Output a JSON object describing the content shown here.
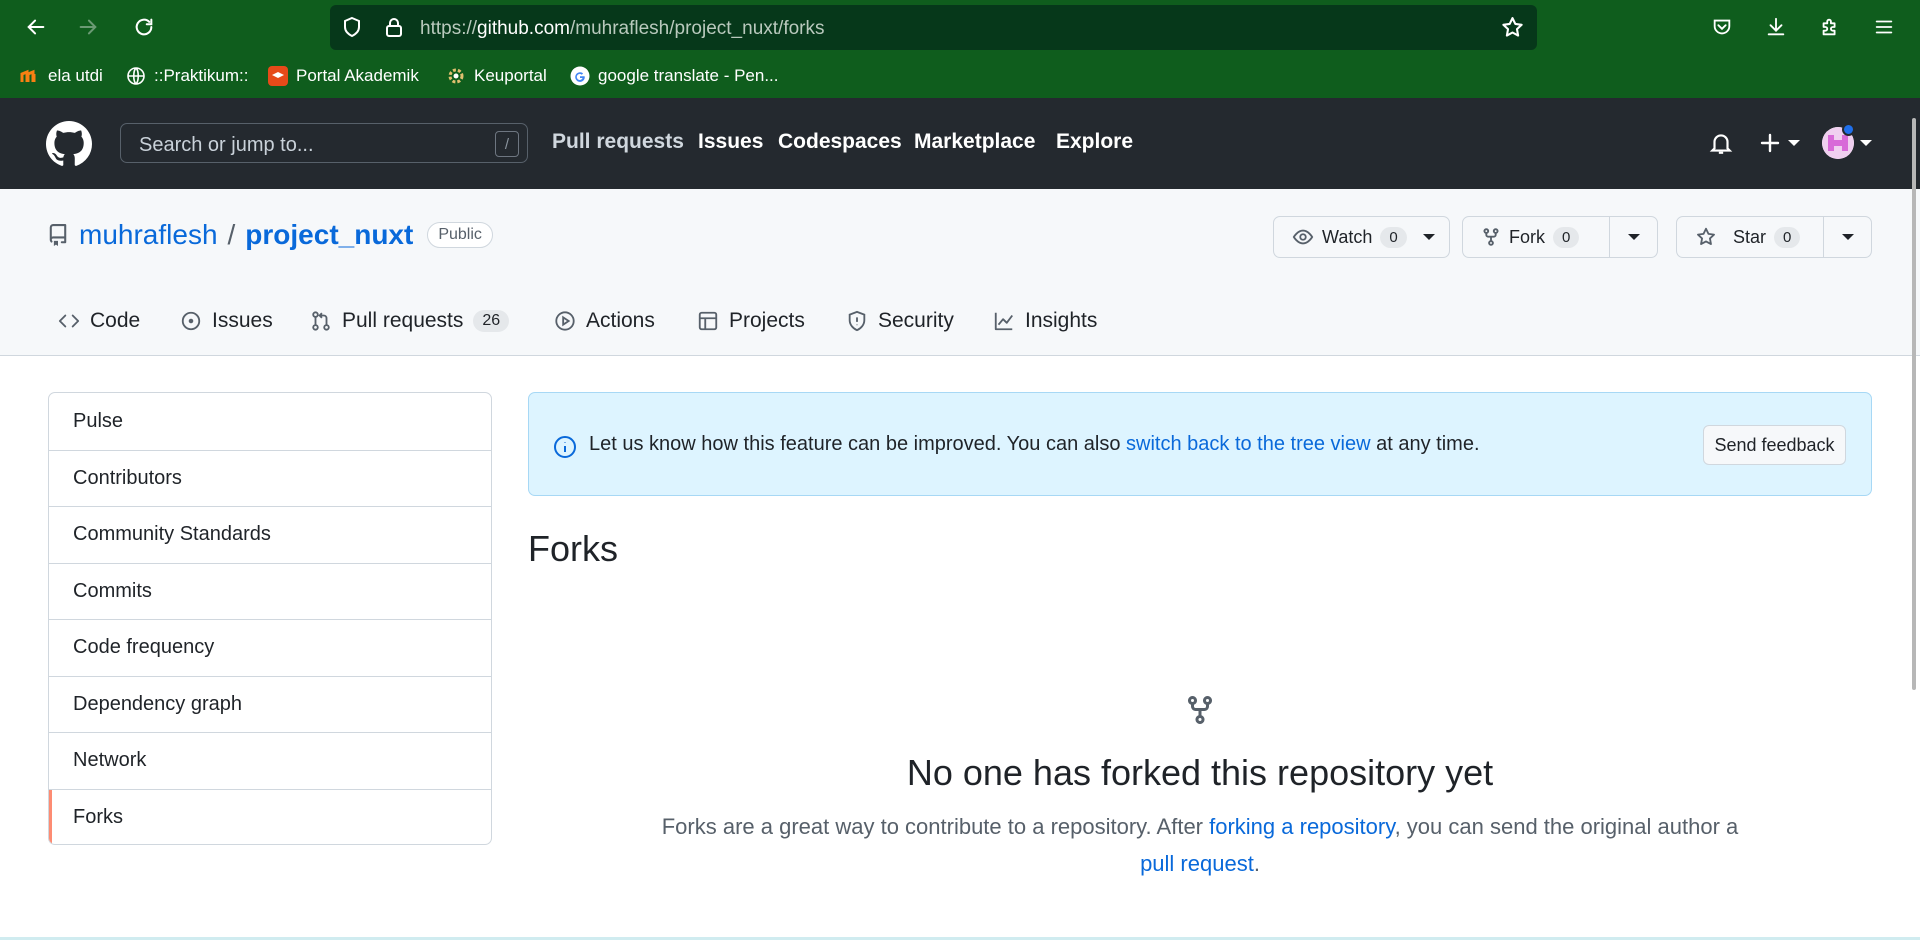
{
  "browser": {
    "url_prefix": "https://",
    "url_domain": "github.com",
    "url_path": "/muhraflesh/project_nuxt/forks",
    "bookmarks": [
      {
        "label": "ela utdi",
        "icon": "moodle-icon"
      },
      {
        "label": "::Praktikum::",
        "icon": "globe-icon"
      },
      {
        "label": "Portal Akademik",
        "icon": "portal-icon"
      },
      {
        "label": "Keuportal",
        "icon": "gear-icon"
      },
      {
        "label": "google translate - Pen...",
        "icon": "google-icon"
      }
    ]
  },
  "header": {
    "search_placeholder": "Search or jump to...",
    "search_key": "/",
    "nav": [
      "Pull requests",
      "Issues",
      "Codespaces",
      "Marketplace",
      "Explore"
    ]
  },
  "repo": {
    "owner": "muhraflesh",
    "separator": "/",
    "name": "project_nuxt",
    "visibility": "Public",
    "watch": {
      "label": "Watch",
      "count": "0"
    },
    "fork": {
      "label": "Fork",
      "count": "0"
    },
    "star": {
      "label": "Star",
      "count": "0"
    },
    "tabs": [
      {
        "label": "Code",
        "icon": "code-icon"
      },
      {
        "label": "Issues",
        "icon": "issue-icon"
      },
      {
        "label": "Pull requests",
        "icon": "pull-request-icon",
        "count": "26"
      },
      {
        "label": "Actions",
        "icon": "play-icon"
      },
      {
        "label": "Projects",
        "icon": "table-icon"
      },
      {
        "label": "Security",
        "icon": "shield-icon"
      },
      {
        "label": "Insights",
        "icon": "graph-icon"
      }
    ]
  },
  "sidebar": {
    "items": [
      "Pulse",
      "Contributors",
      "Community Standards",
      "Commits",
      "Code frequency",
      "Dependency graph",
      "Network",
      "Forks"
    ],
    "active": "Forks"
  },
  "flash": {
    "text_before": "Let us know how this feature can be improved. You can also ",
    "link": "switch back to the tree view",
    "text_after": " at any time.",
    "button": "Send feedback"
  },
  "main": {
    "title": "Forks",
    "blank_title": "No one has forked this repository yet",
    "desc_before": "Forks are a great way to contribute to a repository. After ",
    "desc_link1": "forking a repository",
    "desc_middle": ", you can send the original author a",
    "desc_link2": "pull request",
    "desc_after": "."
  },
  "colors": {
    "browser_bg": "#0f5d1d",
    "github_header": "#24292f",
    "link": "#0969da",
    "active_marker": "#fd8c73",
    "flash_bg": "#ddf4ff"
  }
}
